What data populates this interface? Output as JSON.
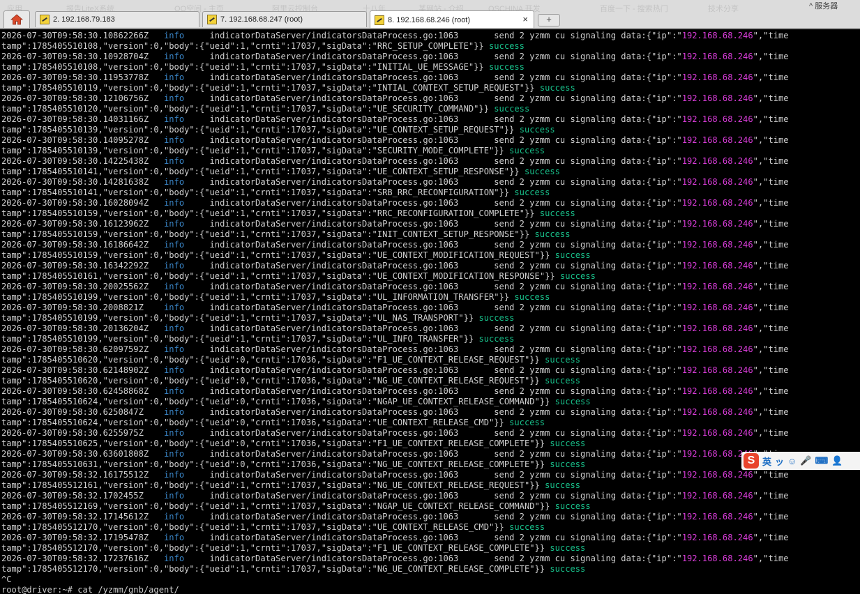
{
  "browser_ghost": {
    "top_right_text": "^ 服务器",
    "ghost_items": [
      "应用",
      "报告LiteX系统",
      "QQ空间 - 主页",
      "阿里云控制台",
      "十八年",
      "某网站 - 介绍",
      "OSCHINA 开发",
      "百度一下 - 搜索热门",
      "技术分享"
    ]
  },
  "tabs": [
    {
      "label": "2. 192.168.79.183",
      "active": false
    },
    {
      "label": "7. 192.168.68.247 (root)",
      "active": false
    },
    {
      "label": "8. 192.168.68.246 (root)",
      "active": true
    }
  ],
  "new_tab_label": "+",
  "close_glyph": "×",
  "terminal": {
    "log_level": "info",
    "source": "indicatorDataServer/indicatorsDataProcess.go:1063",
    "msg_prefix": "send 2 yzmm cu signaling data:{\"ip\":\"",
    "ip": "192.168.68.246",
    "msg_suffix": "\",\"time",
    "stamp_prefix": "tamp\":",
    "success": "success",
    "entries": [
      {
        "ts": "2026-07-30T09:58:30.10862266Z",
        "stamp": "1785405510108",
        "ueid": "1",
        "crnti": "17037",
        "sig": "RRC_SETUP_COMPLETE"
      },
      {
        "ts": "2026-07-30T09:58:30.10928704Z",
        "stamp": "1785405510108",
        "ueid": "1",
        "crnti": "17037",
        "sig": "INITIAL_UE_MESSAGE"
      },
      {
        "ts": "2026-07-30T09:58:30.11953778Z",
        "stamp": "1785405510119",
        "ueid": "1",
        "crnti": "17037",
        "sig": "INTIAL_CONTEXT_SETUP_REQUEST"
      },
      {
        "ts": "2026-07-30T09:58:30.12106756Z",
        "stamp": "1785405510120",
        "ueid": "1",
        "crnti": "17037",
        "sig": "UE_SECURITY_COMMAND"
      },
      {
        "ts": "2026-07-30T09:58:30.14031166Z",
        "stamp": "1785405510139",
        "ueid": "1",
        "crnti": "17037",
        "sig": "UE_CONTEXT_SETUP_REQUEST"
      },
      {
        "ts": "2026-07-30T09:58:30.14095278Z",
        "stamp": "1785405510139",
        "ueid": "1",
        "crnti": "17037",
        "sig": "SECURITY_MODE_COMPLETE"
      },
      {
        "ts": "2026-07-30T09:58:30.14225438Z",
        "stamp": "1785405510141",
        "ueid": "1",
        "crnti": "17037",
        "sig": "UE_CONTEXT_SETUP_RESPONSE"
      },
      {
        "ts": "2026-07-30T09:58:30.14281638Z",
        "stamp": "1785405510141",
        "ueid": "1",
        "crnti": "17037",
        "sig": "SRB_RRC_RECONFIGURATION"
      },
      {
        "ts": "2026-07-30T09:58:30.16028094Z",
        "stamp": "1785405510159",
        "ueid": "1",
        "crnti": "17037",
        "sig": "RRC_RECONFIGURATION_COMPLETE"
      },
      {
        "ts": "2026-07-30T09:58:30.16123962Z",
        "stamp": "1785405510159",
        "ueid": "1",
        "crnti": "17037",
        "sig": "INIT_CONTEXT_SETUP_RESPONSE"
      },
      {
        "ts": "2026-07-30T09:58:30.16186642Z",
        "stamp": "1785405510159",
        "ueid": "1",
        "crnti": "17037",
        "sig": "UE_CONTEXT_MODIFICATION_REQUEST"
      },
      {
        "ts": "2026-07-30T09:58:30.16342292Z",
        "stamp": "1785405510161",
        "ueid": "1",
        "crnti": "17037",
        "sig": "UE_CONTEXT_MODIFICATION_RESPONSE"
      },
      {
        "ts": "2026-07-30T09:58:30.20025562Z",
        "stamp": "1785405510199",
        "ueid": "1",
        "crnti": "17037",
        "sig": "UL_INFORMATION_TRANSFER"
      },
      {
        "ts": "2026-07-30T09:58:30.2008821Z",
        "stamp": "1785405510199",
        "ueid": "1",
        "crnti": "17037",
        "sig": "UL_NAS_TRANSPORT"
      },
      {
        "ts": "2026-07-30T09:58:30.20136204Z",
        "stamp": "1785405510199",
        "ueid": "1",
        "crnti": "17037",
        "sig": "UL_INFO_TRANSFER"
      },
      {
        "ts": "2026-07-30T09:58:30.62097592Z",
        "stamp": "1785405510620",
        "ueid": "0",
        "crnti": "17036",
        "sig": "F1_UE_CONTEXT_RELEASE_REQUEST"
      },
      {
        "ts": "2026-07-30T09:58:30.62148902Z",
        "stamp": "1785405510620",
        "ueid": "0",
        "crnti": "17036",
        "sig": "NG_UE_CONTEXT_RELEASE_REQUEST"
      },
      {
        "ts": "2026-07-30T09:58:30.62458868Z",
        "stamp": "1785405510624",
        "ueid": "0",
        "crnti": "17036",
        "sig": "NGAP_UE_CONTEXT_RELEASE_COMMAND"
      },
      {
        "ts": "2026-07-30T09:58:30.6250847Z",
        "stamp": "1785405510624",
        "ueid": "0",
        "crnti": "17036",
        "sig": "UE_CONTEXT_RELEASE_CMD"
      },
      {
        "ts": "2026-07-30T09:58:30.6255975Z",
        "stamp": "1785405510625",
        "ueid": "0",
        "crnti": "17036",
        "sig": "F1_UE_CONTEXT_RELEASE_COMPLETE"
      },
      {
        "ts": "2026-07-30T09:58:30.63601808Z",
        "stamp": "1785405510631",
        "ueid": "0",
        "crnti": "17036",
        "sig": "NG_UE_CONTEXT_RELEASE_COMPLETE"
      },
      {
        "ts": "2026-07-30T09:58:32.16175512Z",
        "stamp": "1785405512161",
        "ueid": "1",
        "crnti": "17037",
        "sig": "NG_UE_CONTEXT_RELEASE_REQUEST"
      },
      {
        "ts": "2026-07-30T09:58:32.1702455Z",
        "stamp": "1785405512169",
        "ueid": "1",
        "crnti": "17037",
        "sig": "NGAP_UE_CONTEXT_RELEASE_COMMAND"
      },
      {
        "ts": "2026-07-30T09:58:32.17145612Z",
        "stamp": "1785405512170",
        "ueid": "1",
        "crnti": "17037",
        "sig": "UE_CONTEXT_RELEASE_CMD"
      },
      {
        "ts": "2026-07-30T09:58:32.17195478Z",
        "stamp": "1785405512170",
        "ueid": "1",
        "crnti": "17037",
        "sig": "F1_UE_CONTEXT_RELEASE_COMPLETE"
      },
      {
        "ts": "2026-07-30T09:58:32.17237616Z",
        "stamp": "1785405512170",
        "ueid": "1",
        "crnti": "17037",
        "sig": "NG_UE_CONTEXT_RELEASE_COMPLETE"
      }
    ],
    "interrupt": "^C",
    "prompt": "root@driver:~# cat /yzmm/gnb/agent/"
  },
  "ime_toolbar": {
    "logo": "S",
    "lang": "英",
    "glyphs": [
      "ッ",
      "☺",
      "🎤",
      "⌨",
      "👤"
    ]
  },
  "colors": {
    "level": "#3a86c8",
    "ip": "#d83cd8",
    "success": "#18c08a",
    "text": "#d0d0d0",
    "background": "#000000"
  }
}
